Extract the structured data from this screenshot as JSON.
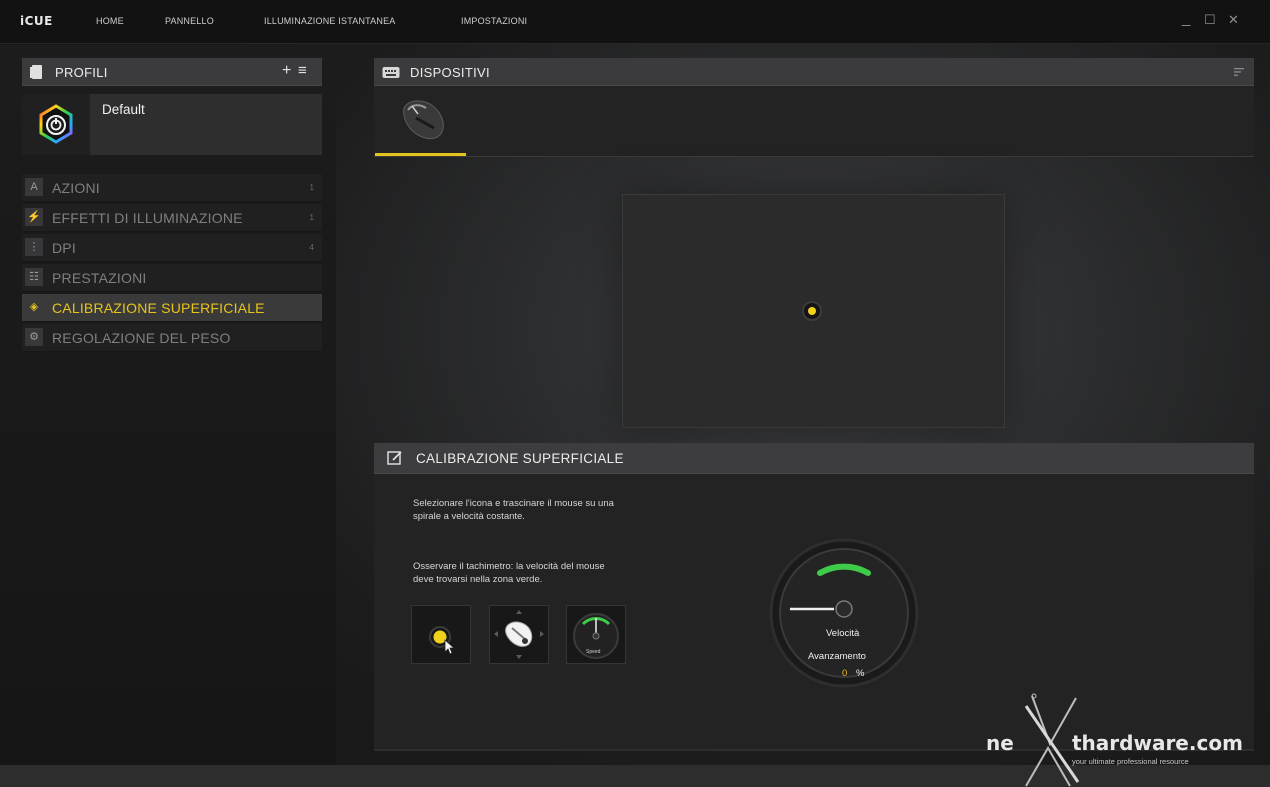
{
  "app": {
    "brand": "iCUE",
    "nav": [
      "HOME",
      "PANNELLO",
      "ILLUMINAZIONE ISTANTANEA",
      "IMPOSTAZIONI"
    ],
    "window_controls": [
      "_",
      "☐",
      "✕"
    ]
  },
  "profiles": {
    "title": "PROFILI",
    "add_label": "+",
    "menu_label": "≡",
    "current": "Default"
  },
  "menu": {
    "items": [
      {
        "icon": "A",
        "label": "AZIONI",
        "count": "1"
      },
      {
        "icon": "⚡",
        "label": "EFFETTI DI ILLUMINAZIONE",
        "count": "1"
      },
      {
        "icon": "⋮",
        "label": "DPI",
        "count": "4"
      },
      {
        "icon": "☷",
        "label": "PRESTAZIONI",
        "count": ""
      },
      {
        "icon": "◈",
        "label": "CALIBRAZIONE SUPERFICIALE",
        "count": ""
      },
      {
        "icon": "⚙",
        "label": "REGOLAZIONE DEL PESO",
        "count": ""
      }
    ],
    "active_index": 4
  },
  "devices": {
    "title": "DISPOSITIVI"
  },
  "calibration": {
    "title": "CALIBRAZIONE SUPERFICIALE",
    "instruction_1": "Selezionare l'icona e trascinare il mouse su una spirale a velocità costante.",
    "instruction_2": "Osservare il tachimetro: la velocità del mouse deve trovarsi nella zona verde.",
    "thumb_speed_label": "Speed",
    "gauge_label": "Velocità",
    "progress_label": "Avanzamento",
    "progress_value": "0",
    "progress_unit": "%"
  },
  "watermark": {
    "brand": "nexthardware.com",
    "brand_left": "ne",
    "brand_right": "thardware.com",
    "tagline": "your ultimate professional resource"
  },
  "colors": {
    "accent": "#e3c31d",
    "gauge_green": "#3ecb4a",
    "progress": "#f0b21a"
  }
}
